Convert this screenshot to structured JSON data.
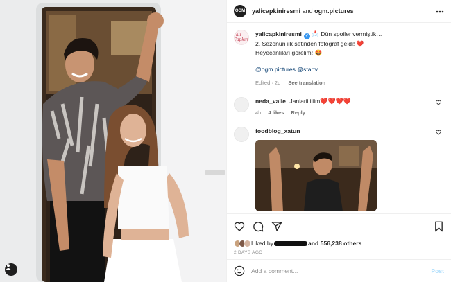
{
  "header": {
    "author": "yalicapkiniresmi",
    "and_text": "and",
    "collaborator": "ogm.pictures",
    "author_avatar_text": "OGM",
    "more_icon": "more-horizontal-icon"
  },
  "caption": {
    "username": "yalicapkiniresmi",
    "verified_icon": "verified-badge-icon",
    "line1": "📩 Dün spoiler vermiştik…",
    "line2": "2. Sezonun ilk setinden fotoğraf geldi! ❤️",
    "line3": "Heyecanlıları görelim! 🤩",
    "mentions": "@ogm.pictures @startv",
    "edited": "Edited · 2d",
    "see_translation": "See translation",
    "avatar_text": "Yalı Çapkını"
  },
  "comments": [
    {
      "username": "neda_valie",
      "text": "Janlariiiiiiim",
      "hearts": "❤️❤️❤️❤️",
      "time": "4h",
      "likes": "4 likes",
      "reply": "Reply"
    },
    {
      "username": "foodblog_xatun"
    }
  ],
  "actions": {
    "like_icon": "heart-icon",
    "comment_icon": "comment-icon",
    "share_icon": "share-icon",
    "save_icon": "bookmark-icon"
  },
  "likes": {
    "prefix": "Liked by",
    "suffix": "and 556,238 others"
  },
  "date": "2 DAYS AGO",
  "add_comment": {
    "placeholder": "Add a comment...",
    "post_label": "Post",
    "emoji_icon": "emoji-icon"
  },
  "colors": {
    "link": "#00376b",
    "verified": "#3897f0",
    "heart": "#ed1c3a",
    "post_disabled": "#b2dffc",
    "meta_grey": "#8e8e8e"
  }
}
